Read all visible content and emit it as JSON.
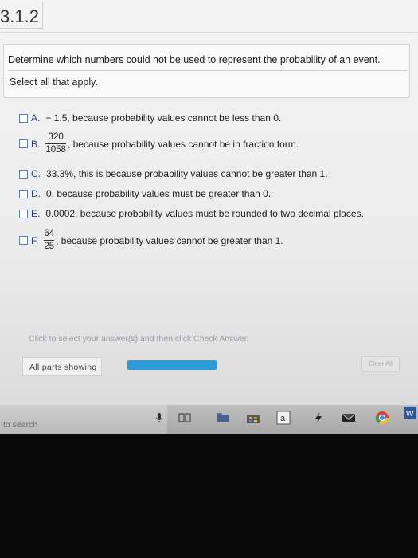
{
  "section": {
    "number": "3.1.2"
  },
  "question": {
    "text": "Determine which numbers could not be used to represent the probability of an event.",
    "instruction": "Select all that apply."
  },
  "options": [
    {
      "letter": "A.",
      "text": "− 1.5, because probability values cannot be less than 0."
    },
    {
      "letter": "B.",
      "numerator": "320",
      "denominator": "1058",
      "text": ", because probability values cannot be in fraction form."
    },
    {
      "letter": "C.",
      "text": "33.3%, this is because probability values cannot be greater than 1."
    },
    {
      "letter": "D.",
      "text": "0, because probability values must be greater than 0."
    },
    {
      "letter": "E.",
      "text": "0.0002, because probability values must be rounded to two decimal places."
    },
    {
      "letter": "F.",
      "numerator": "64",
      "denominator": "25",
      "text": ", because probability values cannot be greater than 1."
    }
  ],
  "footer": {
    "hint": "Click to select your answer(s) and then click Check Answer.",
    "parts_label": "All parts showing",
    "progress": 1.0,
    "clear_label": "Clear All"
  },
  "taskbar": {
    "search_text": "to search",
    "icons": [
      "microphone-icon",
      "task-view-icon",
      "file-explorer-icon",
      "store-icon",
      "app-a-icon",
      "sparrow-icon",
      "mail-icon",
      "chrome-icon",
      "word-icon"
    ]
  },
  "colors": {
    "accent": "#2e9bd6",
    "checkbox_border": "#5a7fb5"
  }
}
